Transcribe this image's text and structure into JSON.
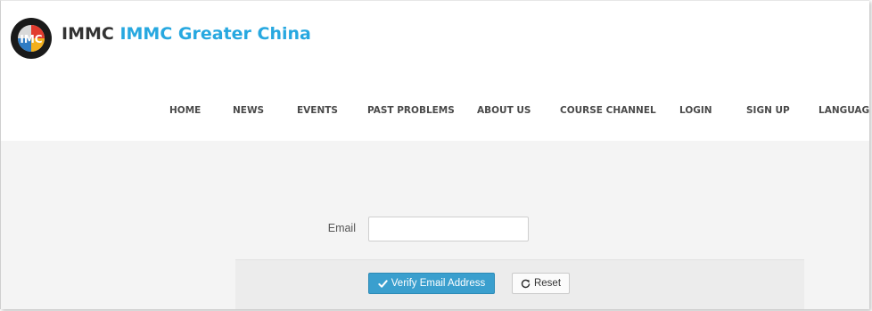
{
  "header": {
    "brand_prefix": "IMMC",
    "brand_name": "IMMC Greater China",
    "brand_color": "#27a8e0"
  },
  "nav": {
    "items": [
      {
        "label": "HOME"
      },
      {
        "label": "NEWS"
      },
      {
        "label": "EVENTS"
      },
      {
        "label": "PAST PROBLEMS"
      },
      {
        "label": "ABOUT US"
      },
      {
        "label": "COURSE CHANNEL"
      },
      {
        "label": "LOGIN"
      },
      {
        "label": "SIGN UP"
      },
      {
        "label": "LANGUAGE"
      }
    ]
  },
  "form": {
    "email_label": "Email",
    "email_value": "",
    "verify_label": "Verify Email Address",
    "reset_label": "Reset",
    "verify_icon": "check-icon",
    "reset_icon": "refresh-icon",
    "button_color": "#3a9fce"
  }
}
